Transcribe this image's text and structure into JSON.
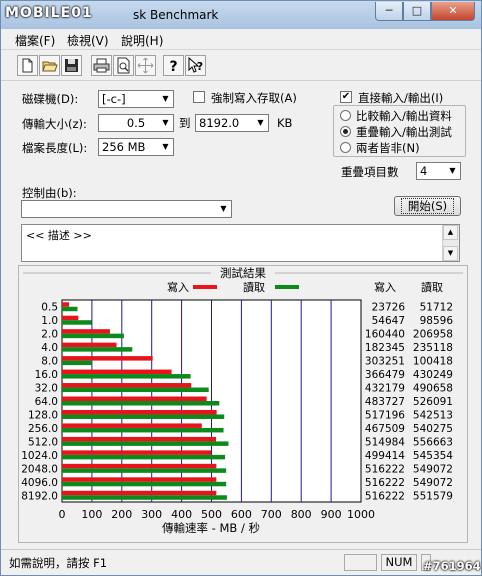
{
  "titlebar": {
    "logo_text": "MOBILE01",
    "title": "sk Benchmark"
  },
  "window_controls": {
    "minimize": "─",
    "maximize": "□",
    "close": "✕"
  },
  "menu": {
    "file": "檔案(F)",
    "view": "檢視(V)",
    "help": "說明(H)"
  },
  "toolbar": {
    "icons": [
      "new-icon",
      "open-icon",
      "save-icon",
      "print-icon",
      "print-preview-icon",
      "move-icon",
      "help-icon",
      "context-help-icon"
    ]
  },
  "settings": {
    "drive_label": "磁碟機(D):",
    "drive_value": "[-c-]",
    "transfer_label": "傳輸大小(z):",
    "transfer_from": "0.5",
    "to_label": "到",
    "transfer_to": "8192.0",
    "kb_label": "KB",
    "length_label": "檔案長度(L):",
    "length_value": "256 MB",
    "force_write_label": "強制寫入存取(A)",
    "force_write_checked": false,
    "direct_io_label": "直接輸入/輸出(I)",
    "direct_io_checked": true,
    "radio_compare": "比較輸入/輸出資料",
    "radio_overlap": "重疊輸入/輸出測試",
    "radio_neither": "兩者皆非(N)",
    "selected_radio": "radio_overlap",
    "queue_label": "重疊項目數",
    "queue_value": "4",
    "control_label": "控制由(b):",
    "control_value": "",
    "start_button": "開始(S)",
    "description": "<< 描述 >>"
  },
  "results": {
    "title": "測試結果",
    "write_legend": "寫入",
    "read_legend": "讀取",
    "write_col": "寫入",
    "read_col": "讀取",
    "write_color": "#e8141b",
    "read_color": "#0c8a1c",
    "xlabel": "傳輸速率 - MB / 秒"
  },
  "chart_data": {
    "type": "bar",
    "orientation": "horizontal",
    "title": "測試結果",
    "xlabel": "傳輸速率 - MB / 秒",
    "xlim": [
      0,
      1000
    ],
    "xticks": [
      0,
      100,
      200,
      300,
      400,
      500,
      600,
      700,
      800,
      900,
      1000
    ],
    "grid": true,
    "legend_position": "top",
    "categories": [
      "0.5",
      "1.0",
      "2.0",
      "4.0",
      "8.0",
      "16.0",
      "32.0",
      "64.0",
      "128.0",
      "256.0",
      "512.0",
      "1024.0",
      "2048.0",
      "4096.0",
      "8192.0"
    ],
    "series": [
      {
        "name": "寫入",
        "values": [
          23.7,
          54.6,
          160.4,
          182.3,
          303.3,
          366.5,
          432.2,
          483.7,
          517.2,
          467.5,
          515.0,
          499.4,
          516.2,
          516.2,
          516.2
        ]
      },
      {
        "name": "讀取",
        "values": [
          51.7,
          98.6,
          207.0,
          235.1,
          100.4,
          430.2,
          490.7,
          526.1,
          542.5,
          540.3,
          556.7,
          545.4,
          549.1,
          549.1,
          551.6
        ]
      }
    ],
    "table": {
      "write": [
        "23726",
        "54647",
        "160440",
        "182345",
        "303251",
        "366479",
        "432179",
        "483727",
        "517196",
        "467509",
        "514984",
        "499414",
        "516222",
        "516222",
        "516222"
      ],
      "read": [
        "51712",
        "98596",
        "206958",
        "235118",
        "100418",
        "430249",
        "490658",
        "526091",
        "542513",
        "540275",
        "556663",
        "545354",
        "549072",
        "549072",
        "551579"
      ]
    }
  },
  "statusbar": {
    "help_text": "如需說明，請按 F1",
    "num": "NUM",
    "watermark": "#761964"
  }
}
